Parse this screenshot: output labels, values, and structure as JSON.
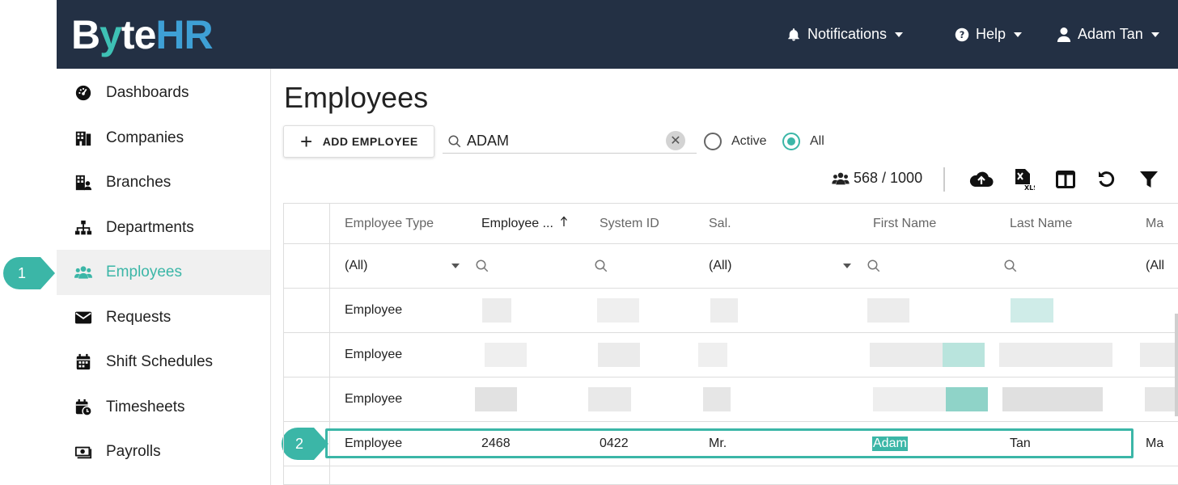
{
  "app": {
    "logo": {
      "b": "B",
      "y": "y",
      "te": "te",
      "hr": "HR"
    },
    "topnav": {
      "notifications": "Notifications",
      "help": "Help",
      "user": "Adam Tan"
    }
  },
  "sidebar": {
    "items": [
      {
        "label": "Dashboards",
        "icon": "dashboard-icon"
      },
      {
        "label": "Companies",
        "icon": "building-icon"
      },
      {
        "label": "Branches",
        "icon": "branch-icon"
      },
      {
        "label": "Departments",
        "icon": "sitemap-icon"
      },
      {
        "label": "Employees",
        "icon": "users-icon",
        "active": true
      },
      {
        "label": "Requests",
        "icon": "envelope-icon"
      },
      {
        "label": "Shift Schedules",
        "icon": "calendar-icon"
      },
      {
        "label": "Timesheets",
        "icon": "calendar-clock-icon"
      },
      {
        "label": "Payrolls",
        "icon": "money-icon"
      }
    ]
  },
  "markers": {
    "step1": "1",
    "step2": "2"
  },
  "main": {
    "title": "Employees",
    "add_button": "ADD EMPLOYEE",
    "search": {
      "value": "ADAM"
    },
    "filters": {
      "active": "Active",
      "all": "All",
      "selected": "All"
    },
    "count": "568 / 1000",
    "toolbar": [
      "upload-icon",
      "xls-export-icon",
      "columns-icon",
      "reset-icon",
      "filter-icon"
    ]
  },
  "grid": {
    "columns": [
      "Employee Type",
      "Employee ...",
      "System ID",
      "Sal.",
      "First Name",
      "Last Name",
      "Ma"
    ],
    "sorted_column": "Employee ...",
    "filter_row": {
      "type": "(All)",
      "sal": "(All)",
      "ma": "(All"
    },
    "rows": [
      {
        "type": "Employee"
      },
      {
        "type": "Employee"
      },
      {
        "type": "Employee"
      },
      {
        "type": "Employee",
        "employee_no": "2468",
        "system_id": "0422",
        "sal": "Mr.",
        "first_name": "Adam",
        "last_name": "Tan",
        "ma": "Ma"
      }
    ]
  },
  "colors": {
    "accent": "#3bb6a7",
    "topbar": "#233044"
  }
}
